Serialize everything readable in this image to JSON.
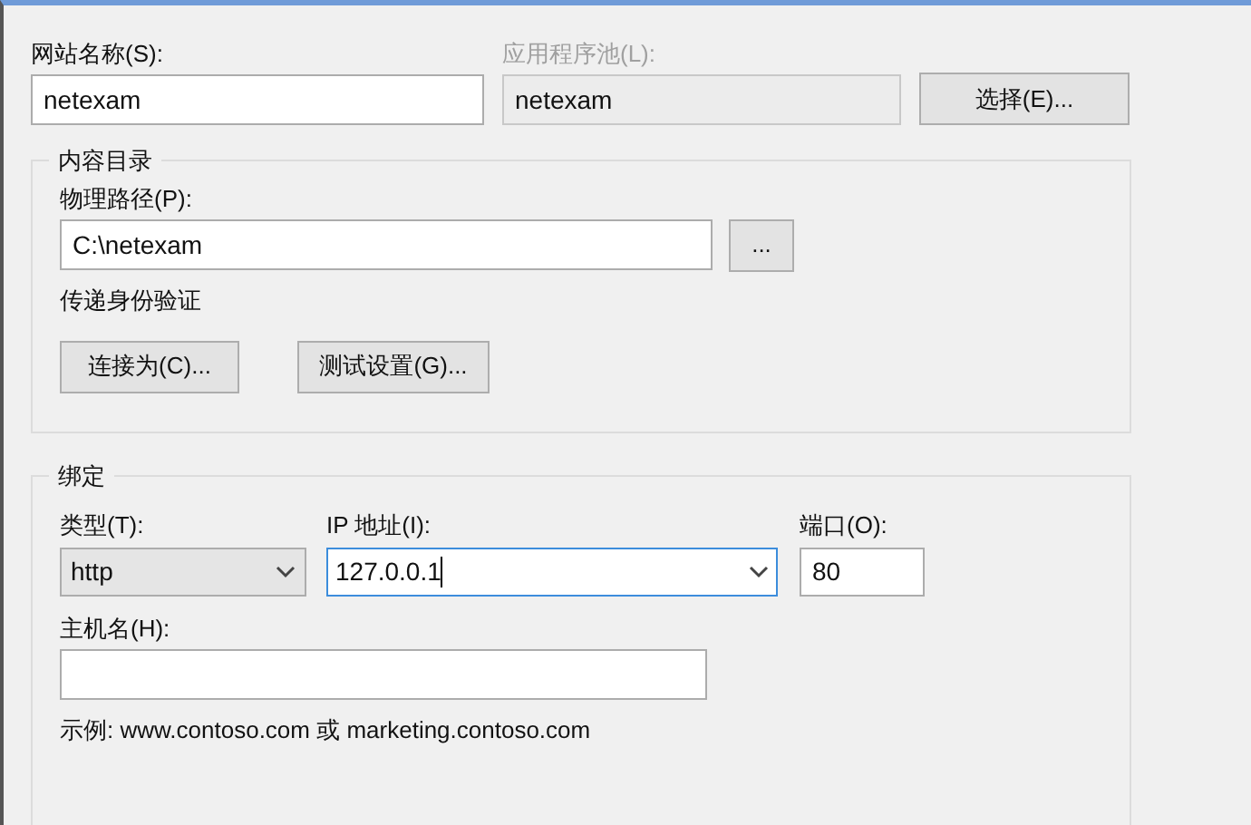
{
  "site_name": {
    "label": "网站名称(S):",
    "value": "netexam"
  },
  "app_pool": {
    "label": "应用程序池(L):",
    "value": "netexam",
    "disabled": true
  },
  "select_button": "选择(E)...",
  "content_directory": {
    "title": "内容目录",
    "physical_path": {
      "label": "物理路径(P):",
      "value": "C:\\netexam"
    },
    "browse_button": "...",
    "pass_through_auth": "传递身份验证",
    "buttons": [
      "连接为(C)...",
      "测试设置(G)..."
    ]
  },
  "binding": {
    "title": "绑定",
    "type": {
      "label": "类型(T):",
      "value": "http"
    },
    "ip_address": {
      "label": "IP 地址(I):",
      "value": "127.0.0.1",
      "focused": true
    },
    "port": {
      "label": "端口(O):",
      "value": "80"
    },
    "host_name": {
      "label": "主机名(H):"
    },
    "example": "示例: www.contoso.com 或 marketing.contoso.com"
  }
}
